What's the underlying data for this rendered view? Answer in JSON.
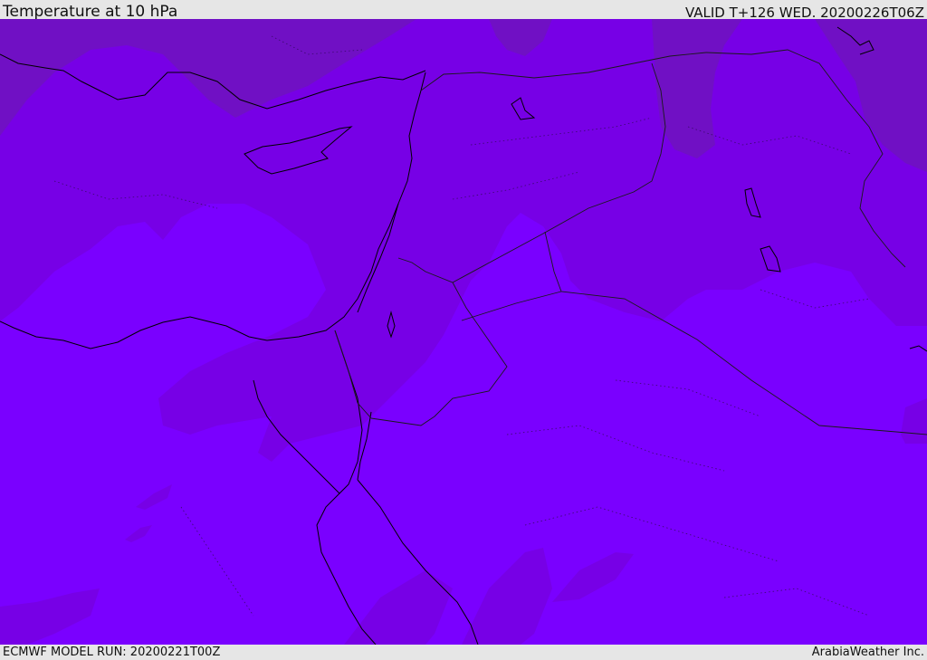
{
  "header": {
    "title": "Temperature at 10 hPa",
    "valid": "VALID T+126 WED. 20200226T06Z"
  },
  "footer": {
    "model_run": "ECMWF MODEL RUN: 20200221T00Z",
    "credit": "ArabiaWeather Inc."
  },
  "colors": {
    "field_light": "#7a00ff",
    "field_mid": "#7700e6",
    "field_dark": "#7010c4",
    "coastline": "#000000",
    "border": "#1a1a1a",
    "background": "#e6e6e6"
  }
}
